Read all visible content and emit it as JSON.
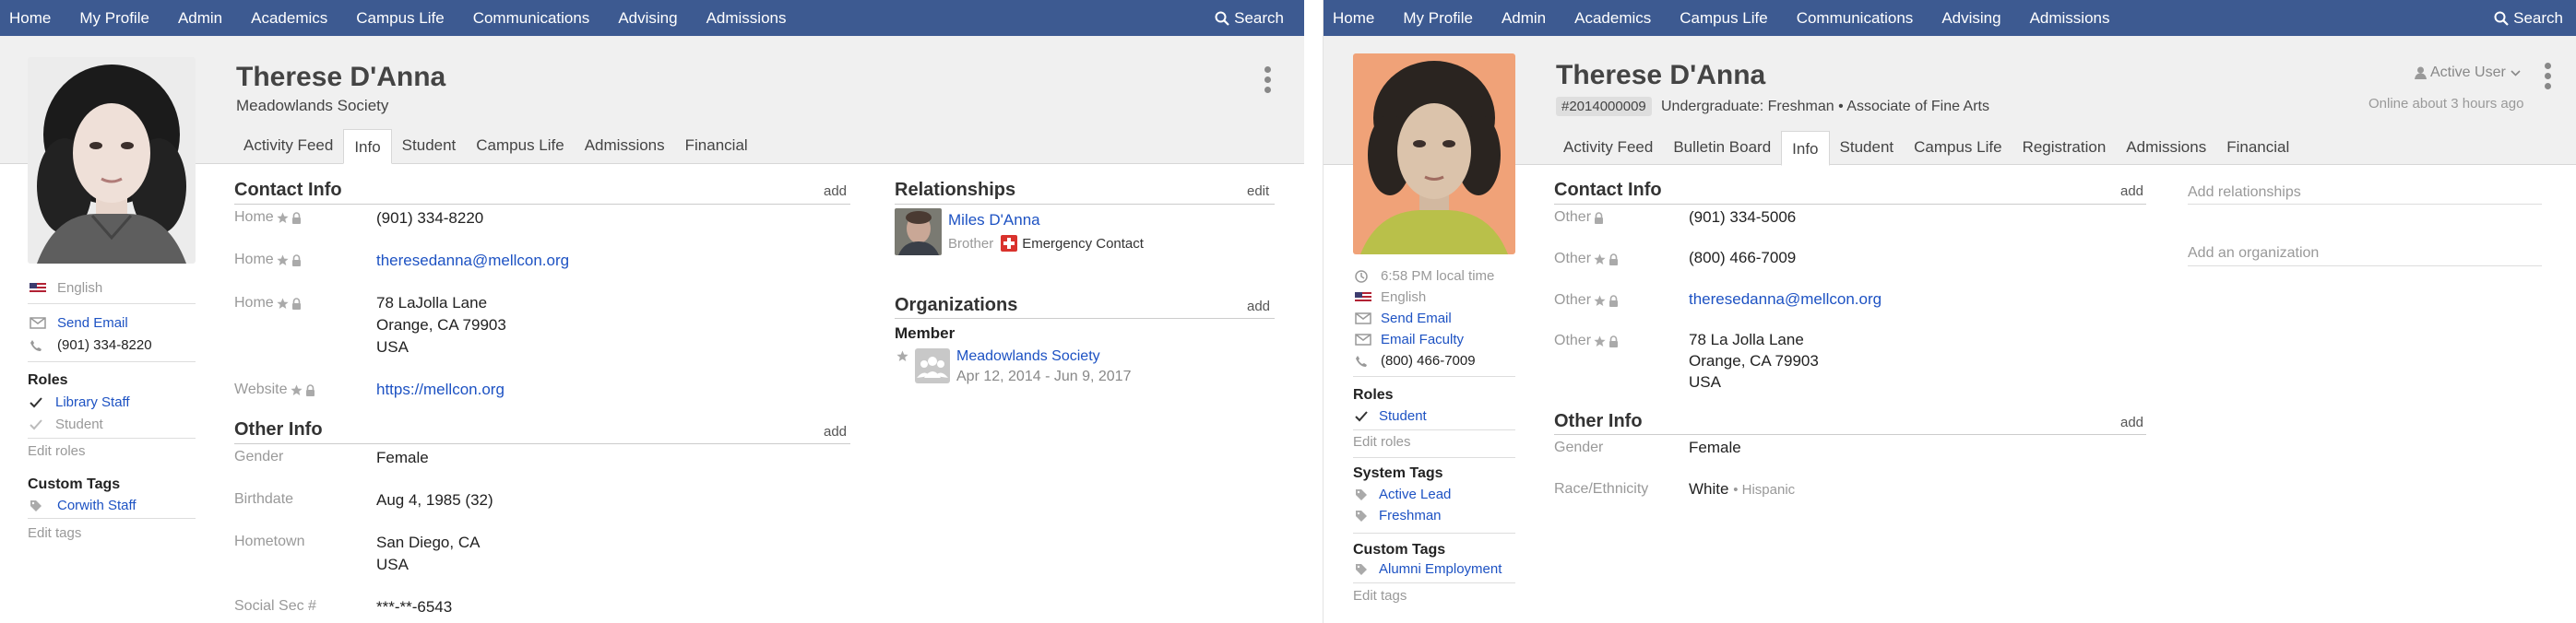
{
  "nav": {
    "items": [
      "Home",
      "My Profile",
      "Admin",
      "Academics",
      "Campus Life",
      "Communications",
      "Advising",
      "Admissions"
    ],
    "search_label": "Search"
  },
  "left": {
    "name": "Therese D'Anna",
    "subtitle": "Meadowlands Society",
    "tabs": [
      "Activity Feed",
      "Info",
      "Student",
      "Campus Life",
      "Admissions",
      "Financial"
    ],
    "active_tab": "Info",
    "sidebar": {
      "language": "English",
      "send_email": "Send Email",
      "phone": "(901) 334-8220",
      "roles_title": "Roles",
      "roles": [
        {
          "label": "Library Staff",
          "active": true
        },
        {
          "label": "Student",
          "active": false
        }
      ],
      "edit_roles": "Edit roles",
      "custom_tags_title": "Custom Tags",
      "custom_tags": [
        "Corwith Staff"
      ],
      "edit_tags": "Edit tags"
    },
    "contact": {
      "title": "Contact Info",
      "action": "add",
      "rows": [
        {
          "label": "Home",
          "lines": [
            "(901) 334-8220"
          ],
          "link": false
        },
        {
          "label": "Home",
          "lines": [
            "theresedanna@mellcon.org"
          ],
          "link": true
        },
        {
          "label": "Home",
          "lines": [
            "78 LaJolla Lane",
            "Orange, CA 79903",
            "USA"
          ],
          "link": false
        },
        {
          "label": "Website",
          "lines": [
            "https://mellcon.org"
          ],
          "link": true
        }
      ]
    },
    "other": {
      "title": "Other Info",
      "action": "add",
      "rows": [
        {
          "label": "Gender",
          "lines": [
            "Female"
          ]
        },
        {
          "label": "Birthdate",
          "lines": [
            "Aug 4, 1985 (32)"
          ]
        },
        {
          "label": "Hometown",
          "lines": [
            "San Diego, CA",
            "USA"
          ]
        },
        {
          "label": "Social Sec #",
          "lines": [
            "***-**-6543"
          ]
        }
      ]
    },
    "relationships": {
      "title": "Relationships",
      "action": "edit",
      "person": "Miles D'Anna",
      "relation": "Brother",
      "emergency": "Emergency Contact"
    },
    "organizations": {
      "title": "Organizations",
      "action": "add",
      "group_title": "Member",
      "org_name": "Meadowlands Society",
      "org_dates": "Apr 12, 2014 - Jun 9, 2017"
    }
  },
  "right": {
    "name": "Therese D'Anna",
    "id_badge": "#2014000009",
    "subtitle": "Undergraduate: Freshman • Associate of Fine Arts",
    "status": "Active User",
    "online": "Online about 3 hours ago",
    "tabs": [
      "Activity Feed",
      "Bulletin Board",
      "Info",
      "Student",
      "Campus Life",
      "Registration",
      "Admissions",
      "Financial"
    ],
    "active_tab": "Info",
    "sidebar": {
      "local_time": "6:58 PM local time",
      "language": "English",
      "send_email": "Send Email",
      "email_faculty": "Email Faculty",
      "phone": "(800) 466-7009",
      "roles_title": "Roles",
      "roles": [
        "Student"
      ],
      "edit_roles": "Edit roles",
      "system_tags_title": "System Tags",
      "system_tags": [
        "Active Lead",
        "Freshman"
      ],
      "custom_tags_title": "Custom Tags",
      "custom_tags": [
        "Alumni Employment"
      ],
      "edit_tags": "Edit tags"
    },
    "contact": {
      "title": "Contact Info",
      "action": "add",
      "rows": [
        {
          "label": "Other",
          "lines": [
            "(901) 334-5006"
          ],
          "link": false
        },
        {
          "label": "Other",
          "lines": [
            "(800) 466-7009"
          ],
          "link": false
        },
        {
          "label": "Other",
          "lines": [
            "theresedanna@mellcon.org"
          ],
          "link": true
        },
        {
          "label": "Other",
          "lines": [
            "78 La Jolla Lane",
            "Orange, CA 79903",
            "USA"
          ],
          "link": false
        }
      ]
    },
    "other": {
      "title": "Other Info",
      "action": "add",
      "gender_label": "Gender",
      "gender": "Female",
      "race_label": "Race/Ethnicity",
      "race": "White",
      "race_sub": "• Hispanic"
    },
    "add_relationships": "Add relationships",
    "add_organization": "Add an organization"
  }
}
